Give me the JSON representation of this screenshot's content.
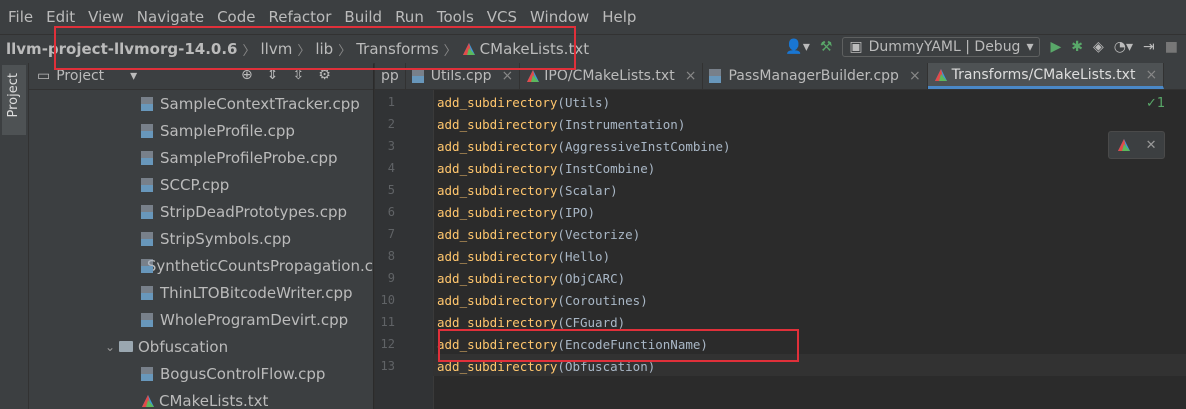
{
  "menu": [
    "File",
    "Edit",
    "View",
    "Navigate",
    "Code",
    "Refactor",
    "Build",
    "Run",
    "Tools",
    "VCS",
    "Window",
    "Help"
  ],
  "breadcrumb": {
    "root": "llvm-project-llvmorg-14.0.6",
    "parts": [
      "llvm",
      "lib",
      "Transforms"
    ],
    "file": "CMakeLists.txt"
  },
  "run_config": "DummyYAML | Debug",
  "side_tab": "Project",
  "project_panel": {
    "title": "Project"
  },
  "tree": [
    {
      "label": "SampleContextTracker.cpp",
      "type": "file"
    },
    {
      "label": "SampleProfile.cpp",
      "type": "file"
    },
    {
      "label": "SampleProfileProbe.cpp",
      "type": "file"
    },
    {
      "label": "SCCP.cpp",
      "type": "file"
    },
    {
      "label": "StripDeadPrototypes.cpp",
      "type": "file"
    },
    {
      "label": "StripSymbols.cpp",
      "type": "file"
    },
    {
      "label": "SyntheticCountsPropagation.c",
      "type": "file"
    },
    {
      "label": "ThinLTOBitcodeWriter.cpp",
      "type": "file"
    },
    {
      "label": "WholeProgramDevirt.cpp",
      "type": "file"
    },
    {
      "label": "Obfuscation",
      "type": "folder"
    },
    {
      "label": "BogusControlFlow.cpp",
      "type": "file"
    },
    {
      "label": "CMakeLists.txt",
      "type": "cmake"
    }
  ],
  "tabs": [
    {
      "label": "pp"
    },
    {
      "label": "Utils.cpp"
    },
    {
      "label": "IPO/CMakeLists.txt"
    },
    {
      "label": "PassManagerBuilder.cpp"
    },
    {
      "label": "Transforms/CMakeLists.txt",
      "active": true
    }
  ],
  "code_lines": [
    {
      "n": "1",
      "fn": "add_subdirectory",
      "arg": "Utils"
    },
    {
      "n": "2",
      "fn": "add_subdirectory",
      "arg": "Instrumentation"
    },
    {
      "n": "3",
      "fn": "add_subdirectory",
      "arg": "AggressiveInstCombine"
    },
    {
      "n": "4",
      "fn": "add_subdirectory",
      "arg": "InstCombine"
    },
    {
      "n": "5",
      "fn": "add_subdirectory",
      "arg": "Scalar"
    },
    {
      "n": "6",
      "fn": "add_subdirectory",
      "arg": "IPO"
    },
    {
      "n": "7",
      "fn": "add_subdirectory",
      "arg": "Vectorize"
    },
    {
      "n": "8",
      "fn": "add_subdirectory",
      "arg": "Hello"
    },
    {
      "n": "9",
      "fn": "add_subdirectory",
      "arg": "ObjCARC"
    },
    {
      "n": "10",
      "fn": "add_subdirectory",
      "arg": "Coroutines"
    },
    {
      "n": "11",
      "fn": "add_subdirectory",
      "arg": "CFGuard"
    },
    {
      "n": "12",
      "fn": "add_subdirectory",
      "arg": "EncodeFunctionName"
    },
    {
      "n": "13",
      "fn": "add_subdirectory",
      "arg": "Obfuscation"
    }
  ],
  "inspection_badge": "✓1",
  "colors": {
    "highlight": "#e0303a",
    "accent": "#4a88c7"
  }
}
